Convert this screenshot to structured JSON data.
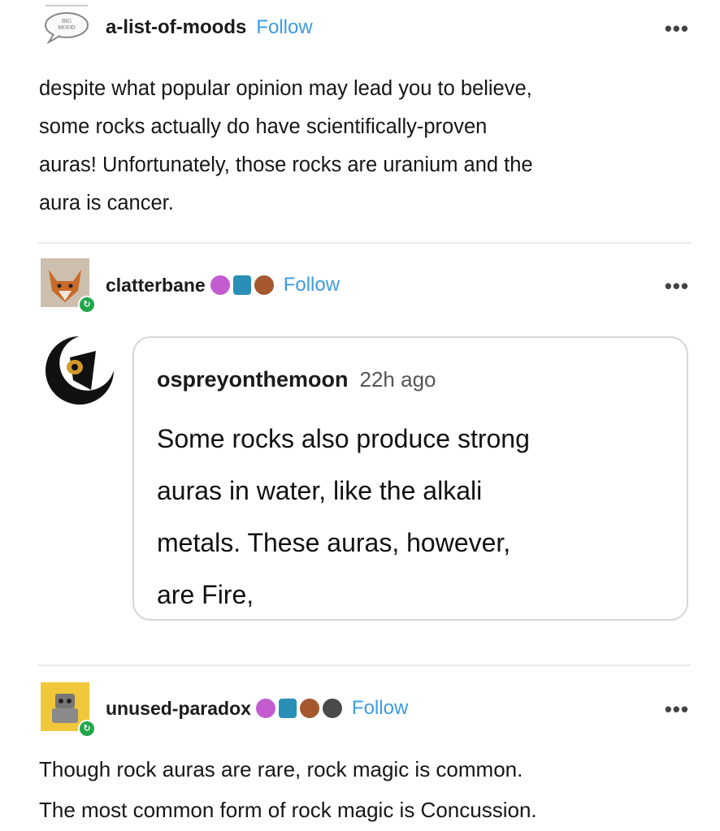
{
  "posts": [
    {
      "username": "a-list-of-moods",
      "follow": "Follow",
      "more": "•••",
      "avatar_text": "BIG MOOD",
      "lines": [
        "despite what popular opinion may lead you to believe,",
        "some rocks actually do have scientifically-proven",
        "auras! Unfortunately, those rocks are uranium and the",
        "aura is cancer."
      ]
    },
    {
      "username": "clatterbane",
      "follow": "Follow",
      "more": "•••",
      "reply": {
        "username": "ospreyonthemoon",
        "time": "22h ago",
        "lines": [
          "Some rocks also produce strong",
          "auras in water, like the alkali",
          "metals. These auras, however,",
          "are Fire,"
        ]
      }
    },
    {
      "username": "unused-paradox",
      "follow": "Follow",
      "more": "•••",
      "lines": [
        "Though rock auras are rare, rock magic is common.",
        "The most common form of rock magic is Concussion."
      ]
    }
  ],
  "colors": {
    "follow": "#3d9be0",
    "badge_green": "#1fa64a"
  }
}
